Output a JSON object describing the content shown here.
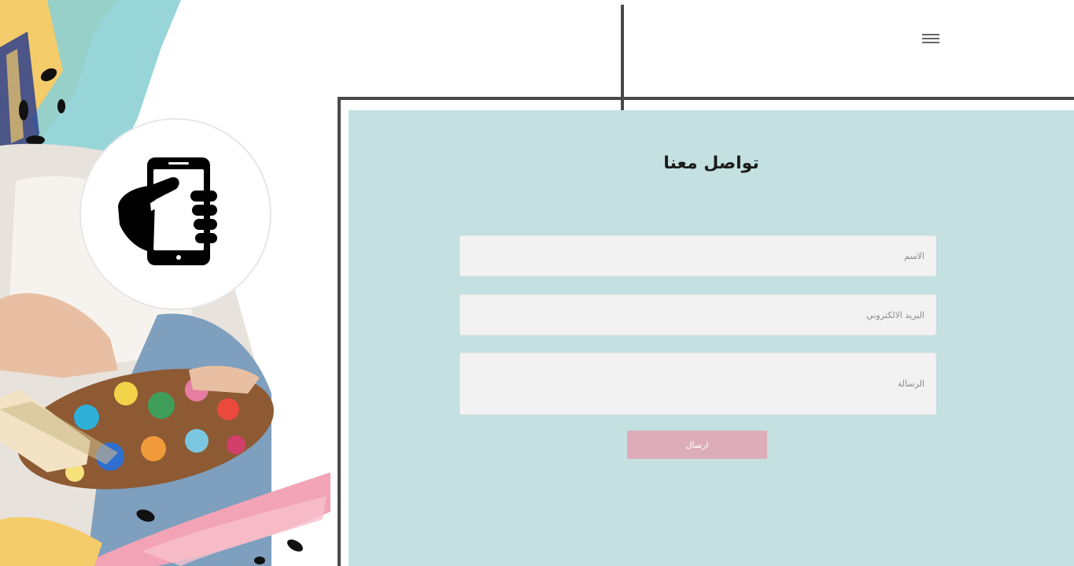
{
  "header": {
    "menu_icon": "hamburger-menu-icon"
  },
  "hero": {
    "phone_icon": "hand-holding-phone-icon"
  },
  "contact": {
    "title": "تواصل معنا",
    "name_placeholder": "الاسم",
    "email_placeholder": "البريد الالكتروني",
    "message_placeholder": "الرسالة",
    "submit_label": "ارسال"
  },
  "colors": {
    "panel_bg": "#c4e0e0",
    "input_bg": "#f2f2f2",
    "button_bg": "#dcadb9",
    "frame": "#4a4a4a"
  }
}
